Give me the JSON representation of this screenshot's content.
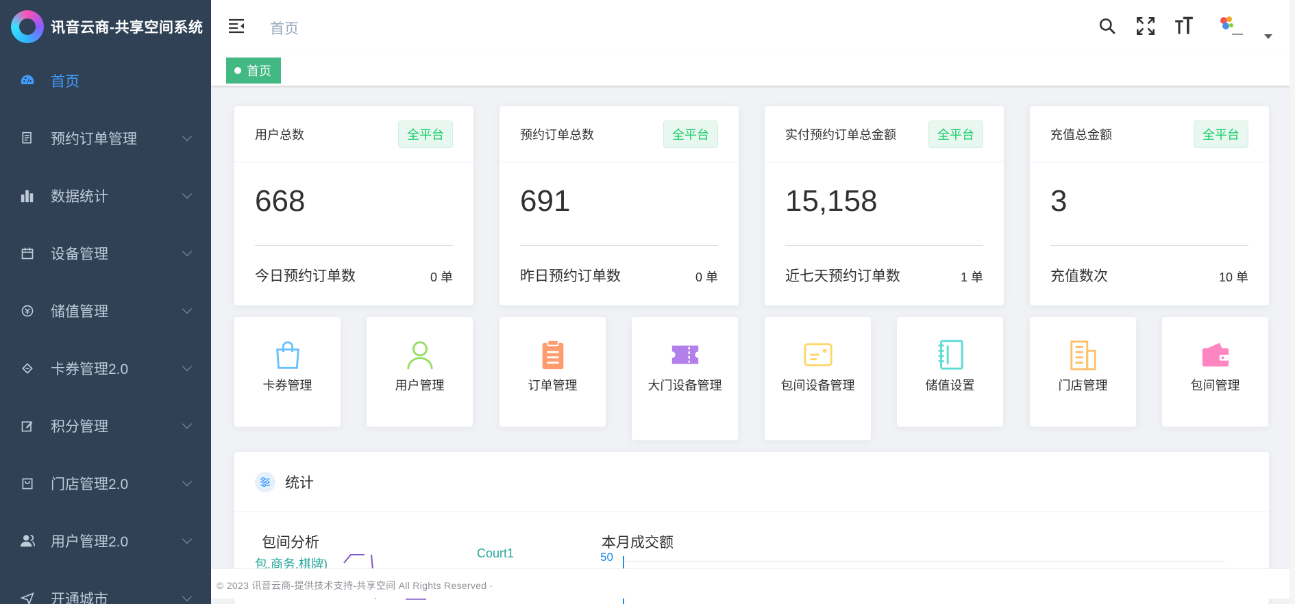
{
  "app": {
    "title": "讯音云商-共享空间系统"
  },
  "sidebar": {
    "items": [
      {
        "label": "首页",
        "icon": "dashboard-icon",
        "active": true
      },
      {
        "label": "预约订单管理",
        "icon": "document-icon"
      },
      {
        "label": "数据统计",
        "icon": "bar-chart-icon"
      },
      {
        "label": "设备管理",
        "icon": "calendar-icon"
      },
      {
        "label": "储值管理",
        "icon": "coin-icon"
      },
      {
        "label": "卡券管理2.0",
        "icon": "ticket-icon"
      },
      {
        "label": "积分管理",
        "icon": "edit-icon"
      },
      {
        "label": "门店管理2.0",
        "icon": "shop-icon"
      },
      {
        "label": "用户管理2.0",
        "icon": "users-icon"
      },
      {
        "label": "开通城市",
        "icon": "send-icon"
      }
    ]
  },
  "header": {
    "breadcrumb": "首页",
    "icons": [
      "search-icon",
      "fullscreen-icon",
      "font-size-icon"
    ]
  },
  "tags": {
    "active": "首页"
  },
  "stats": [
    {
      "title": "用户总数",
      "badge": "全平台",
      "value": "668",
      "sub_label": "今日预约订单数",
      "sub_value": "0 单"
    },
    {
      "title": "预约订单总数",
      "badge": "全平台",
      "value": "691",
      "sub_label": "昨日预约订单数",
      "sub_value": "0 单"
    },
    {
      "title": "实付预约订单总金额",
      "badge": "全平台",
      "value": "15,158",
      "sub_label": "近七天预约订单数",
      "sub_value": "1 单"
    },
    {
      "title": "充值总金额",
      "badge": "全平台",
      "value": "3",
      "sub_label": "充值数次",
      "sub_value": "10 单"
    }
  ],
  "quick_links": [
    {
      "label": "卡券管理",
      "icon": "shopping-bag-icon",
      "color": "#69c0ff"
    },
    {
      "label": "用户管理",
      "icon": "user-icon",
      "color": "#95de64"
    },
    {
      "label": "订单管理",
      "icon": "clipboard-icon",
      "color": "#ff9c6e"
    },
    {
      "label": "大门设备管理",
      "icon": "ticket-icon",
      "color": "#b37feb"
    },
    {
      "label": "包间设备管理",
      "icon": "card-icon",
      "color": "#ffd666"
    },
    {
      "label": "储值设置",
      "icon": "notebook-icon",
      "color": "#5cdbd3"
    },
    {
      "label": "门店管理",
      "icon": "building-icon",
      "color": "#ffc069"
    },
    {
      "label": "包间管理",
      "icon": "wallet-icon",
      "color": "#ff85c0"
    }
  ],
  "statistics": {
    "title": "统计",
    "room_analysis": {
      "title": "包间分析",
      "labels": [
        "包.商务.棋牌)",
        "Court1"
      ]
    },
    "monthly_revenue": {
      "title": "本月成交额",
      "y_tick": "50"
    }
  },
  "footer": {
    "text": "© 2023 讯音云商-提供技术支持-共享空间 All Rights Reserved ·"
  }
}
